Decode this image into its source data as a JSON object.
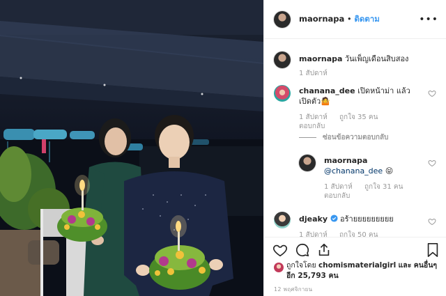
{
  "post": {
    "author": "maornapa",
    "separator": "•",
    "follow_label": "ติดตาม",
    "more_label": "•••",
    "caption_user": "maornapa",
    "caption_text": "วันเพ็ญเดือนสิบสอง",
    "caption_time": "1 สัปดาห์"
  },
  "comments": [
    {
      "user": "chanana_dee",
      "text": "เปิดหน้าม่า แล้วเปิดตัว🤷",
      "time": "1 สัปดาห์",
      "likes": "ถูกใจ 35 คน",
      "reply": "ตอบกลับ",
      "view_replies": "ซ่อนข้อความตอบกลับ"
    },
    {
      "user": "maornapa",
      "mention": "@chanana_dee",
      "text": "😝",
      "time": "1 สัปดาห์",
      "likes": "ถูกใจ 31 คน",
      "reply": "ตอบกลับ"
    },
    {
      "user": "djeaky",
      "text": "อร้ายยยยยยยยย",
      "time": "1 สัปดาห์",
      "likes": "ถูกใจ 50 คน"
    }
  ],
  "likes": {
    "prefix": "ถูกใจโดย",
    "user": "chomismaterialgirl",
    "and": "และ",
    "others": "คนอื่นๆ อีก 25,793 คน"
  },
  "date": "12 พฤศจิกายน",
  "colors": {
    "link": "#3897f0",
    "meta": "#999999",
    "text": "#262626",
    "verified": "#3897f0"
  },
  "icons": [
    "heart-icon",
    "comment-icon",
    "share-icon",
    "bookmark-icon",
    "more-icon"
  ]
}
